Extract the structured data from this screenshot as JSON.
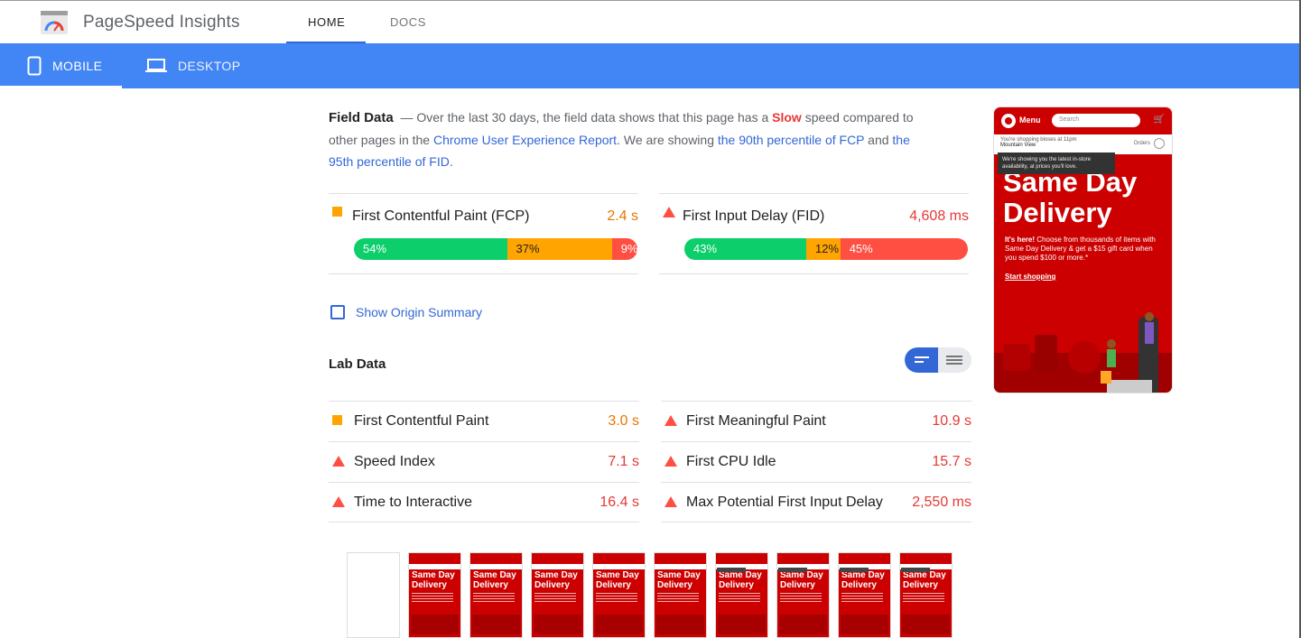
{
  "app": {
    "title": "PageSpeed Insights"
  },
  "nav": {
    "home": "HOME",
    "docs": "DOCS"
  },
  "devices": {
    "mobile": "MOBILE",
    "desktop": "DESKTOP"
  },
  "field": {
    "heading": "Field Data",
    "sep": "—",
    "text1": "Over the last 30 days, the field data shows that this page has a",
    "speed": "Slow",
    "text2": "speed compared to other pages in the",
    "link_report": "Chrome User Experience Report",
    "text3": ". We are showing",
    "link_fcp": "the 90th percentile of FCP",
    "text4": "and",
    "link_fid": "the 95th percentile of FID",
    "text5": ".",
    "fcp": {
      "name": "First Contentful Paint (FCP)",
      "value": "2.4 s",
      "fast": 54,
      "avg": 37,
      "slow": 9,
      "fast_label": "54%",
      "avg_label": "37%",
      "slow_label": "9%"
    },
    "fid": {
      "name": "First Input Delay (FID)",
      "value": "4,608 ms",
      "fast": 43,
      "avg": 12,
      "slow": 45,
      "fast_label": "43%",
      "avg_label": "12%",
      "slow_label": "45%"
    }
  },
  "origin": {
    "label": "Show Origin Summary"
  },
  "lab": {
    "title": "Lab Data",
    "left": [
      {
        "name": "First Contentful Paint",
        "value": "3.0 s",
        "status": "average"
      },
      {
        "name": "Speed Index",
        "value": "7.1 s",
        "status": "slow"
      },
      {
        "name": "Time to Interactive",
        "value": "16.4 s",
        "status": "slow"
      }
    ],
    "right": [
      {
        "name": "First Meaningful Paint",
        "value": "10.9 s",
        "status": "slow"
      },
      {
        "name": "First CPU Idle",
        "value": "15.7 s",
        "status": "slow"
      },
      {
        "name": "Max Potential First Input Delay",
        "value": "2,550 ms",
        "status": "slow"
      }
    ]
  },
  "preview": {
    "menu": "Menu",
    "search": "Search",
    "shopping": "You're shopping bloses at 11pm",
    "store": "Mountain View",
    "orders": "Orders",
    "tooltip": "We're showing you the latest in-store availability, at prices you'll love.",
    "headline": "Same Day Delivery",
    "copy_bold": "It's here!",
    "copy": "Choose from thousands of items with Same Day Delivery & get a $15 gift card when you spend $100 or more.*",
    "cta": "Start shopping"
  },
  "filmstrip": {
    "frame_headline": "Same Day Delivery",
    "frames": 10
  },
  "colors": {
    "accent": "#4285f4",
    "link": "#3367d6",
    "good": "#0cce6b",
    "average": "#ffa400",
    "poor": "#ff4e42",
    "target_red": "#cc0000"
  }
}
